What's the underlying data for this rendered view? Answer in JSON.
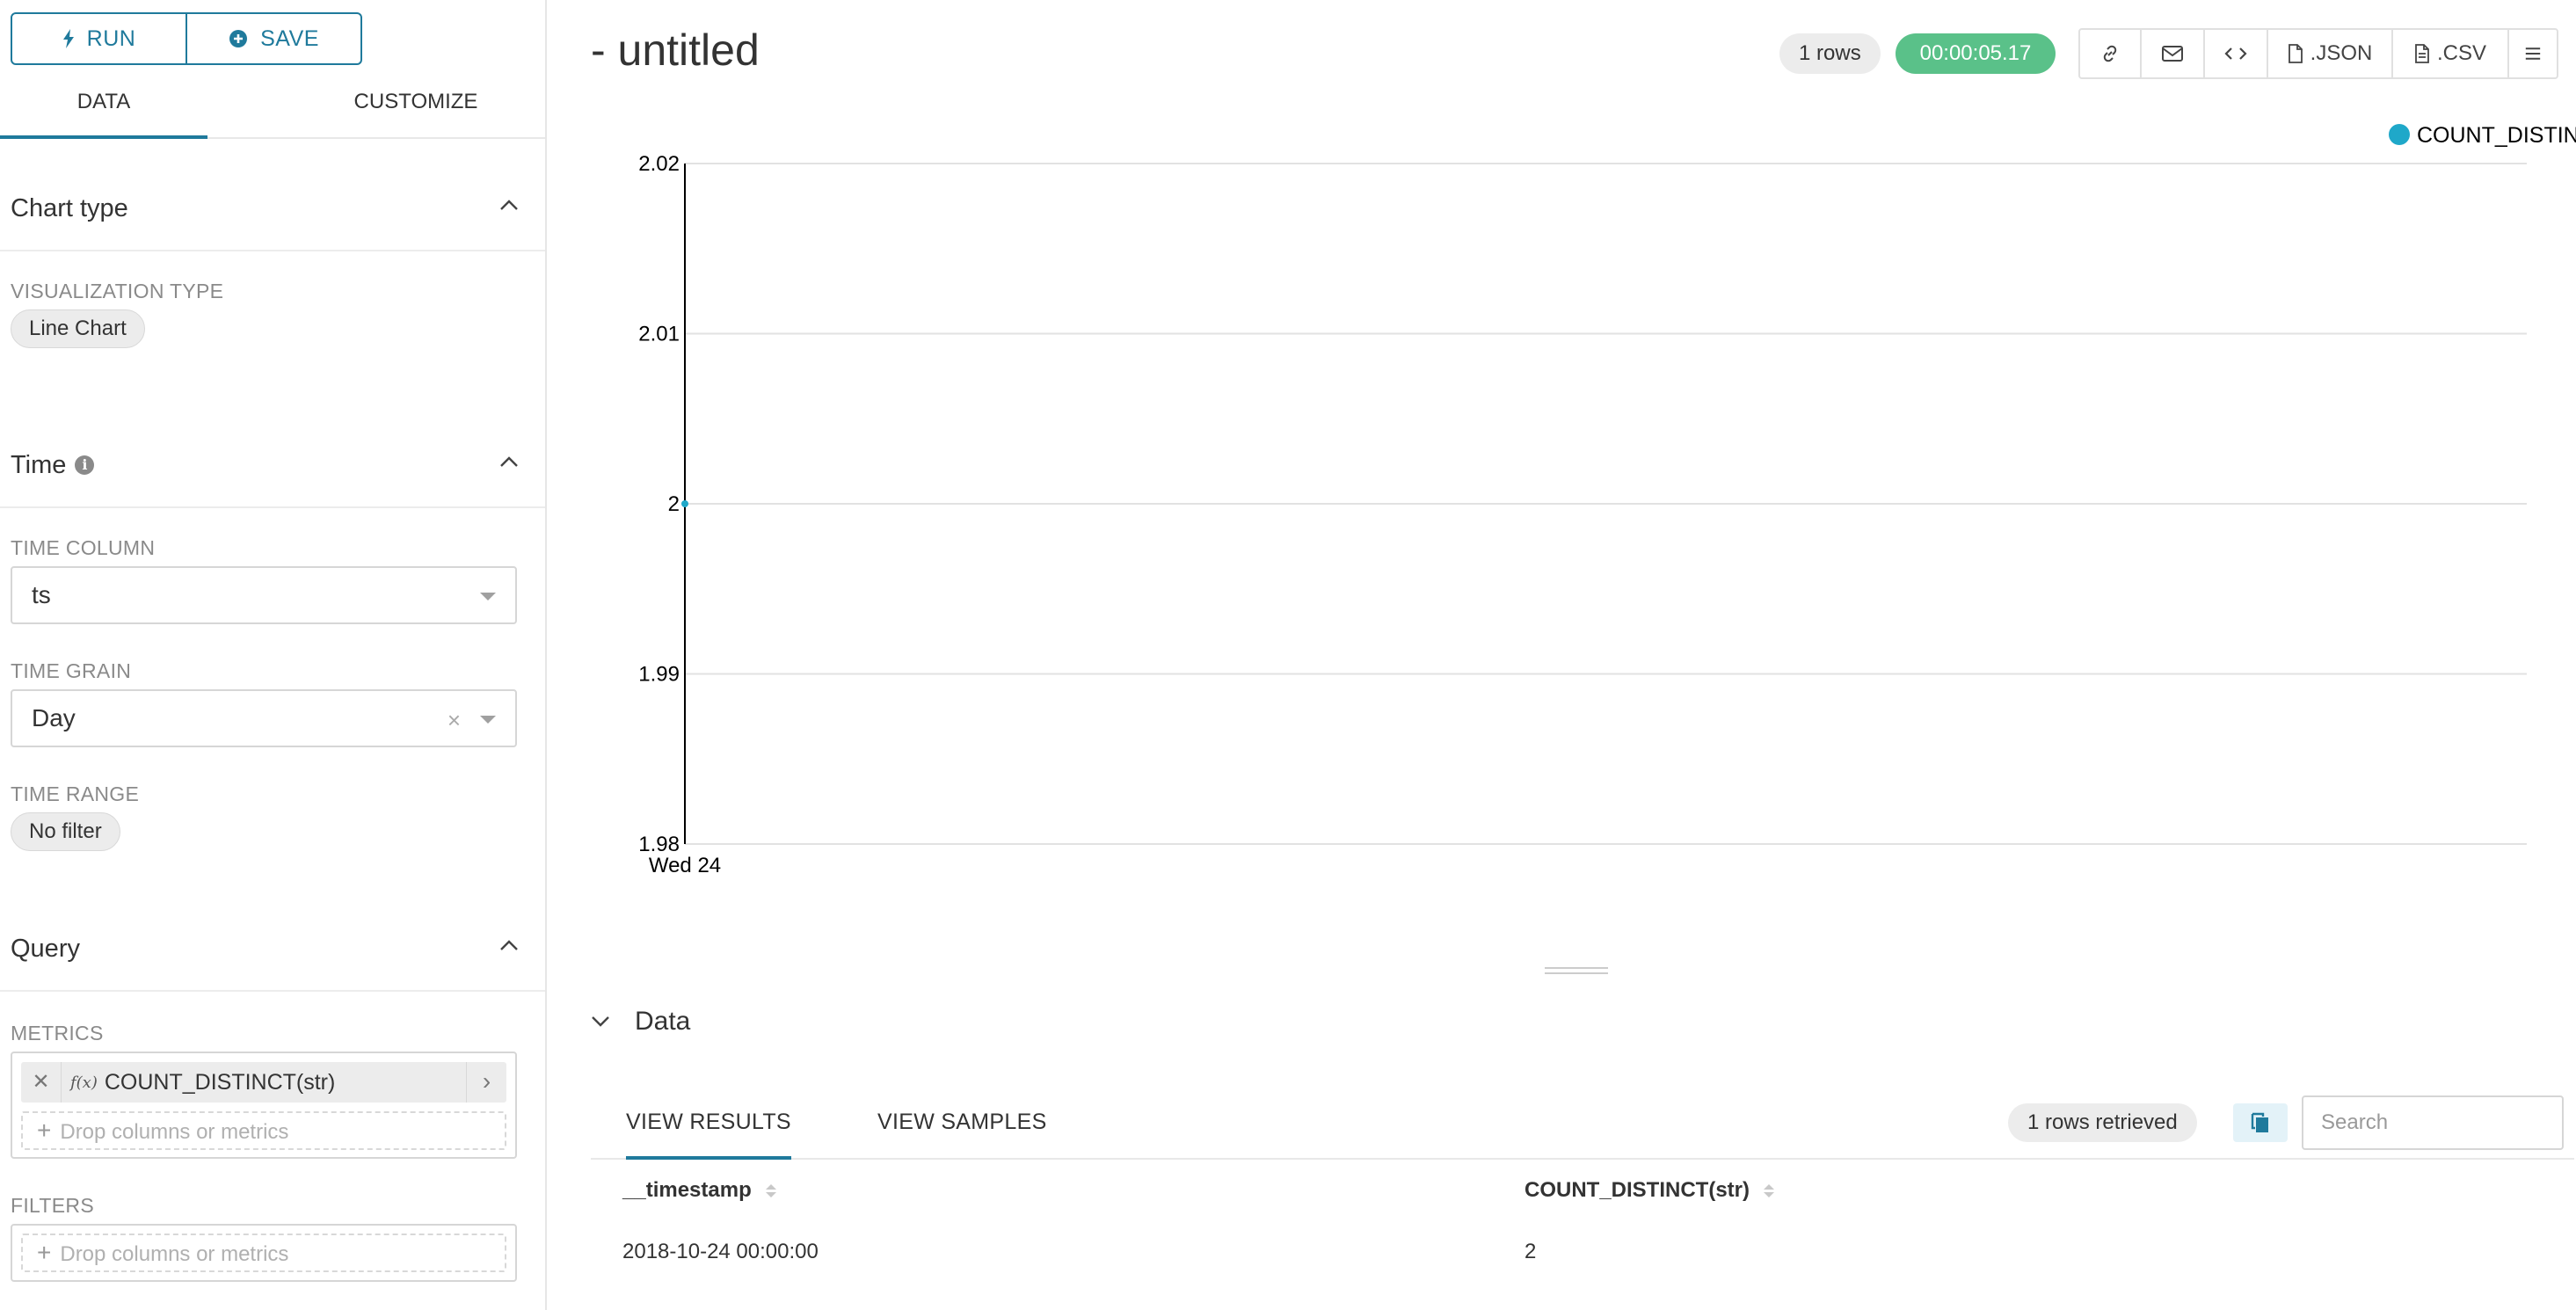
{
  "sidebar": {
    "run_label": "RUN",
    "save_label": "SAVE",
    "tabs": [
      "DATA",
      "CUSTOMIZE"
    ],
    "chart_type": {
      "title": "Chart type",
      "viz_label": "VISUALIZATION TYPE",
      "viz_value": "Line Chart"
    },
    "time": {
      "title": "Time",
      "column_label": "TIME COLUMN",
      "column_value": "ts",
      "grain_label": "TIME GRAIN",
      "grain_value": "Day",
      "range_label": "TIME RANGE",
      "range_value": "No filter"
    },
    "query": {
      "title": "Query",
      "metrics_label": "METRICS",
      "metric_value": "COUNT_DISTINCT(str)",
      "drop_placeholder": "Drop columns or metrics",
      "filters_label": "FILTERS",
      "filters_placeholder": "Drop columns or metrics"
    }
  },
  "header": {
    "title": "- untitled",
    "rows_badge": "1 rows",
    "time_badge": "00:00:05.17",
    "toolbar": {
      "json_label": ".JSON",
      "csv_label": ".CSV"
    }
  },
  "chart_data": {
    "type": "line",
    "x": [
      "Wed 24"
    ],
    "series": [
      {
        "name": "COUNT_DISTINCT(str)",
        "values": [
          2
        ]
      }
    ],
    "yticks": [
      "2.02",
      "2.01",
      "2",
      "1.99",
      "1.98"
    ],
    "ylim": [
      1.98,
      2.02
    ],
    "legend_position": "top-right",
    "grid": true,
    "color": "#1fa8c9"
  },
  "data_panel": {
    "title": "Data",
    "tabs": [
      "VIEW RESULTS",
      "VIEW SAMPLES"
    ],
    "rows_retrieved": "1 rows retrieved",
    "search_placeholder": "Search",
    "columns": [
      "__timestamp",
      "COUNT_DISTINCT(str)"
    ],
    "rows": [
      [
        "2018-10-24 00:00:00",
        "2"
      ]
    ]
  },
  "colors": {
    "accent": "#1f7a9c",
    "success": "#5ac189",
    "series": "#1fa8c9"
  }
}
